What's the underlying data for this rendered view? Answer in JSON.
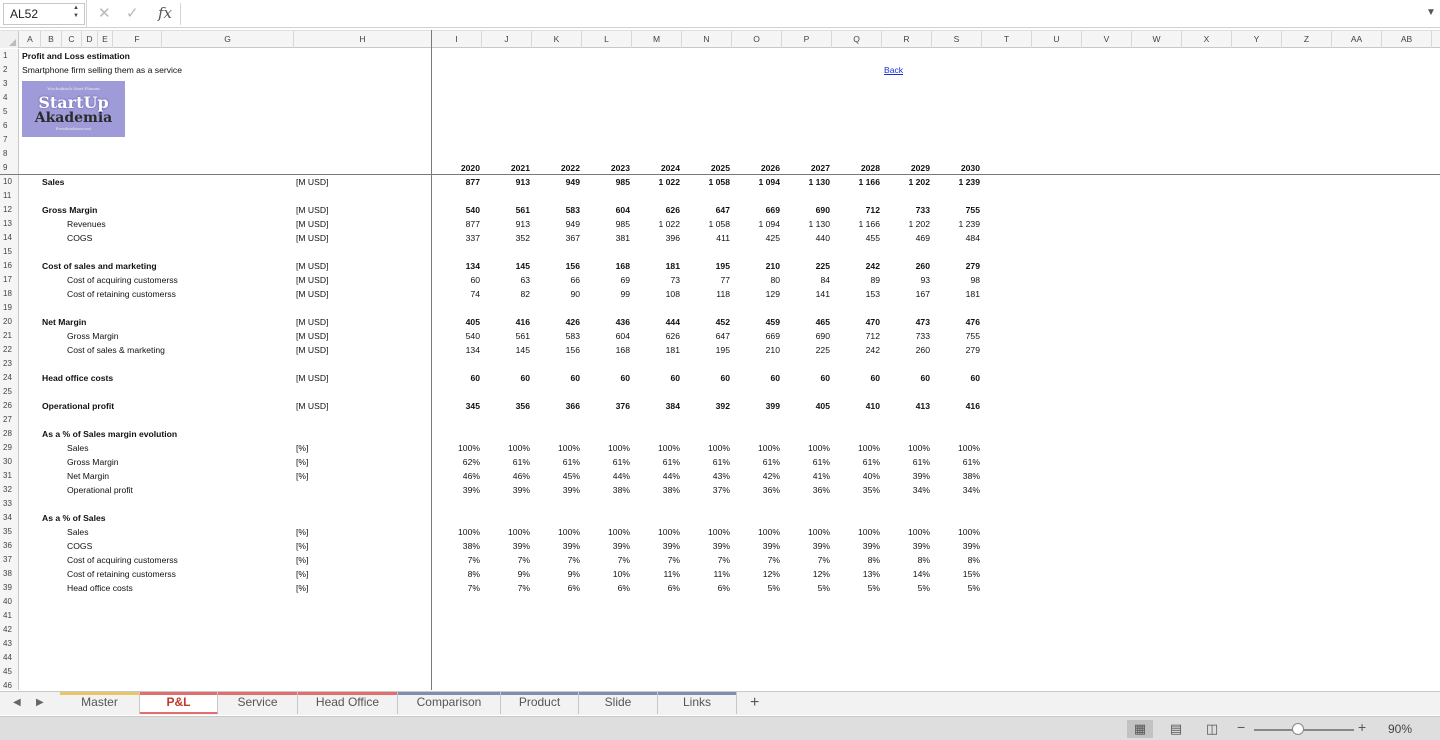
{
  "formula_bar": {
    "name_box": "AL52",
    "cancel_icon": "x-icon",
    "confirm_icon": "check-icon",
    "fx_label": "fx",
    "formula": ""
  },
  "columns": [
    "A",
    "B",
    "C",
    "D",
    "E",
    "F",
    "G",
    "H",
    "I",
    "J",
    "K",
    "L",
    "M",
    "N",
    "O",
    "P",
    "Q",
    "R",
    "S",
    "T",
    "U",
    "V",
    "W",
    "X",
    "Y",
    "Z",
    "AA",
    "AB"
  ],
  "title": "Profit and Loss estimation",
  "subtitle": "Smartphone firm selling them as a service",
  "back_link": "Back",
  "logo": {
    "top_text": "Wschodnich Start Planem",
    "line1": "StartUp",
    "line2": "Akademia",
    "bottom_text": "Przedsiebiorcosci"
  },
  "years": [
    "2020",
    "2021",
    "2022",
    "2023",
    "2024",
    "2025",
    "2026",
    "2027",
    "2028",
    "2029",
    "2030"
  ],
  "table_rows": [
    {
      "row": 10,
      "label": "Sales",
      "indent": false,
      "bold": true,
      "unit": "[M USD]",
      "values": [
        "877",
        "913",
        "949",
        "985",
        "1 022",
        "1 058",
        "1 094",
        "1 130",
        "1 166",
        "1 202",
        "1 239"
      ]
    },
    {
      "row": 12,
      "label": "Gross Margin",
      "indent": false,
      "bold": true,
      "unit": "[M USD]",
      "values": [
        "540",
        "561",
        "583",
        "604",
        "626",
        "647",
        "669",
        "690",
        "712",
        "733",
        "755"
      ]
    },
    {
      "row": 13,
      "label": "Revenues",
      "indent": true,
      "bold": false,
      "unit": "[M USD]",
      "values": [
        "877",
        "913",
        "949",
        "985",
        "1 022",
        "1 058",
        "1 094",
        "1 130",
        "1 166",
        "1 202",
        "1 239"
      ]
    },
    {
      "row": 14,
      "label": "COGS",
      "indent": true,
      "bold": false,
      "unit": "[M USD]",
      "values": [
        "337",
        "352",
        "367",
        "381",
        "396",
        "411",
        "425",
        "440",
        "455",
        "469",
        "484"
      ]
    },
    {
      "row": 16,
      "label": "Cost of sales and marketing",
      "indent": false,
      "bold": true,
      "unit": "[M USD]",
      "values": [
        "134",
        "145",
        "156",
        "168",
        "181",
        "195",
        "210",
        "225",
        "242",
        "260",
        "279"
      ]
    },
    {
      "row": 17,
      "label": "Cost of acquiring customerss",
      "indent": true,
      "bold": false,
      "unit": "[M USD]",
      "values": [
        "60",
        "63",
        "66",
        "69",
        "73",
        "77",
        "80",
        "84",
        "89",
        "93",
        "98"
      ]
    },
    {
      "row": 18,
      "label": "Cost of retaining customerss",
      "indent": true,
      "bold": false,
      "unit": "[M USD]",
      "values": [
        "74",
        "82",
        "90",
        "99",
        "108",
        "118",
        "129",
        "141",
        "153",
        "167",
        "181"
      ]
    },
    {
      "row": 20,
      "label": "Net Margin",
      "indent": false,
      "bold": true,
      "unit": "[M USD]",
      "values": [
        "405",
        "416",
        "426",
        "436",
        "444",
        "452",
        "459",
        "465",
        "470",
        "473",
        "476"
      ]
    },
    {
      "row": 21,
      "label": "Gross Margin",
      "indent": true,
      "bold": false,
      "unit": "[M USD]",
      "values": [
        "540",
        "561",
        "583",
        "604",
        "626",
        "647",
        "669",
        "690",
        "712",
        "733",
        "755"
      ]
    },
    {
      "row": 22,
      "label": "Cost of sales & marketing",
      "indent": true,
      "bold": false,
      "unit": "[M USD]",
      "values": [
        "134",
        "145",
        "156",
        "168",
        "181",
        "195",
        "210",
        "225",
        "242",
        "260",
        "279"
      ]
    },
    {
      "row": 24,
      "label": "Head office costs",
      "indent": false,
      "bold": true,
      "unit": "[M USD]",
      "values": [
        "60",
        "60",
        "60",
        "60",
        "60",
        "60",
        "60",
        "60",
        "60",
        "60",
        "60"
      ]
    },
    {
      "row": 26,
      "label": "Operational profit",
      "indent": false,
      "bold": true,
      "unit": "[M USD]",
      "values": [
        "345",
        "356",
        "366",
        "376",
        "384",
        "392",
        "399",
        "405",
        "410",
        "413",
        "416"
      ]
    },
    {
      "row": 28,
      "label": "As a % of Sales margin evolution",
      "indent": false,
      "bold": true,
      "unit": "",
      "values": []
    },
    {
      "row": 29,
      "label": "Sales",
      "indent": true,
      "bold": false,
      "unit": "[%]",
      "values": [
        "100%",
        "100%",
        "100%",
        "100%",
        "100%",
        "100%",
        "100%",
        "100%",
        "100%",
        "100%",
        "100%"
      ]
    },
    {
      "row": 30,
      "label": "Gross Margin",
      "indent": true,
      "bold": false,
      "unit": "[%]",
      "values": [
        "62%",
        "61%",
        "61%",
        "61%",
        "61%",
        "61%",
        "61%",
        "61%",
        "61%",
        "61%",
        "61%"
      ]
    },
    {
      "row": 31,
      "label": "Net Margin",
      "indent": true,
      "bold": false,
      "unit": "[%]",
      "values": [
        "46%",
        "46%",
        "45%",
        "44%",
        "44%",
        "43%",
        "42%",
        "41%",
        "40%",
        "39%",
        "38%"
      ]
    },
    {
      "row": 32,
      "label": "Operational profit",
      "indent": true,
      "bold": false,
      "unit": "",
      "values": [
        "39%",
        "39%",
        "39%",
        "38%",
        "38%",
        "37%",
        "36%",
        "36%",
        "35%",
        "34%",
        "34%"
      ]
    },
    {
      "row": 34,
      "label": "As a % of Sales",
      "indent": false,
      "bold": true,
      "unit": "",
      "values": []
    },
    {
      "row": 35,
      "label": "Sales",
      "indent": true,
      "bold": false,
      "unit": "[%]",
      "values": [
        "100%",
        "100%",
        "100%",
        "100%",
        "100%",
        "100%",
        "100%",
        "100%",
        "100%",
        "100%",
        "100%"
      ]
    },
    {
      "row": 36,
      "label": "COGS",
      "indent": true,
      "bold": false,
      "unit": "[%]",
      "values": [
        "38%",
        "39%",
        "39%",
        "39%",
        "39%",
        "39%",
        "39%",
        "39%",
        "39%",
        "39%",
        "39%"
      ]
    },
    {
      "row": 37,
      "label": "Cost of acquiring customerss",
      "indent": true,
      "bold": false,
      "unit": "[%]",
      "values": [
        "7%",
        "7%",
        "7%",
        "7%",
        "7%",
        "7%",
        "7%",
        "7%",
        "8%",
        "8%",
        "8%"
      ]
    },
    {
      "row": 38,
      "label": "Cost of retaining customerss",
      "indent": true,
      "bold": false,
      "unit": "[%]",
      "values": [
        "8%",
        "9%",
        "9%",
        "10%",
        "11%",
        "11%",
        "12%",
        "12%",
        "13%",
        "14%",
        "15%"
      ]
    },
    {
      "row": 39,
      "label": "Head office costs",
      "indent": true,
      "bold": false,
      "unit": "[%]",
      "values": [
        "7%",
        "7%",
        "6%",
        "6%",
        "6%",
        "6%",
        "5%",
        "5%",
        "5%",
        "5%",
        "5%"
      ]
    }
  ],
  "sheet_tabs": [
    {
      "label": "Master",
      "color": "#e8c766",
      "active": false
    },
    {
      "label": "P&L",
      "color": "#e07070",
      "active": true
    },
    {
      "label": "Service",
      "color": "#e07070",
      "active": false
    },
    {
      "label": "Head Office",
      "color": "#e07070",
      "active": false
    },
    {
      "label": "Comparison",
      "color": "#7d8fb0",
      "active": false
    },
    {
      "label": "Product",
      "color": "#7d8fb0",
      "active": false
    },
    {
      "label": "Slide",
      "color": "#7d8fb0",
      "active": false
    },
    {
      "label": "Links",
      "color": "#7d8fb0",
      "active": false
    }
  ],
  "status_bar": {
    "views": [
      "normal-view-icon",
      "page-layout-icon",
      "page-break-icon"
    ],
    "zoom_level": "90%"
  }
}
